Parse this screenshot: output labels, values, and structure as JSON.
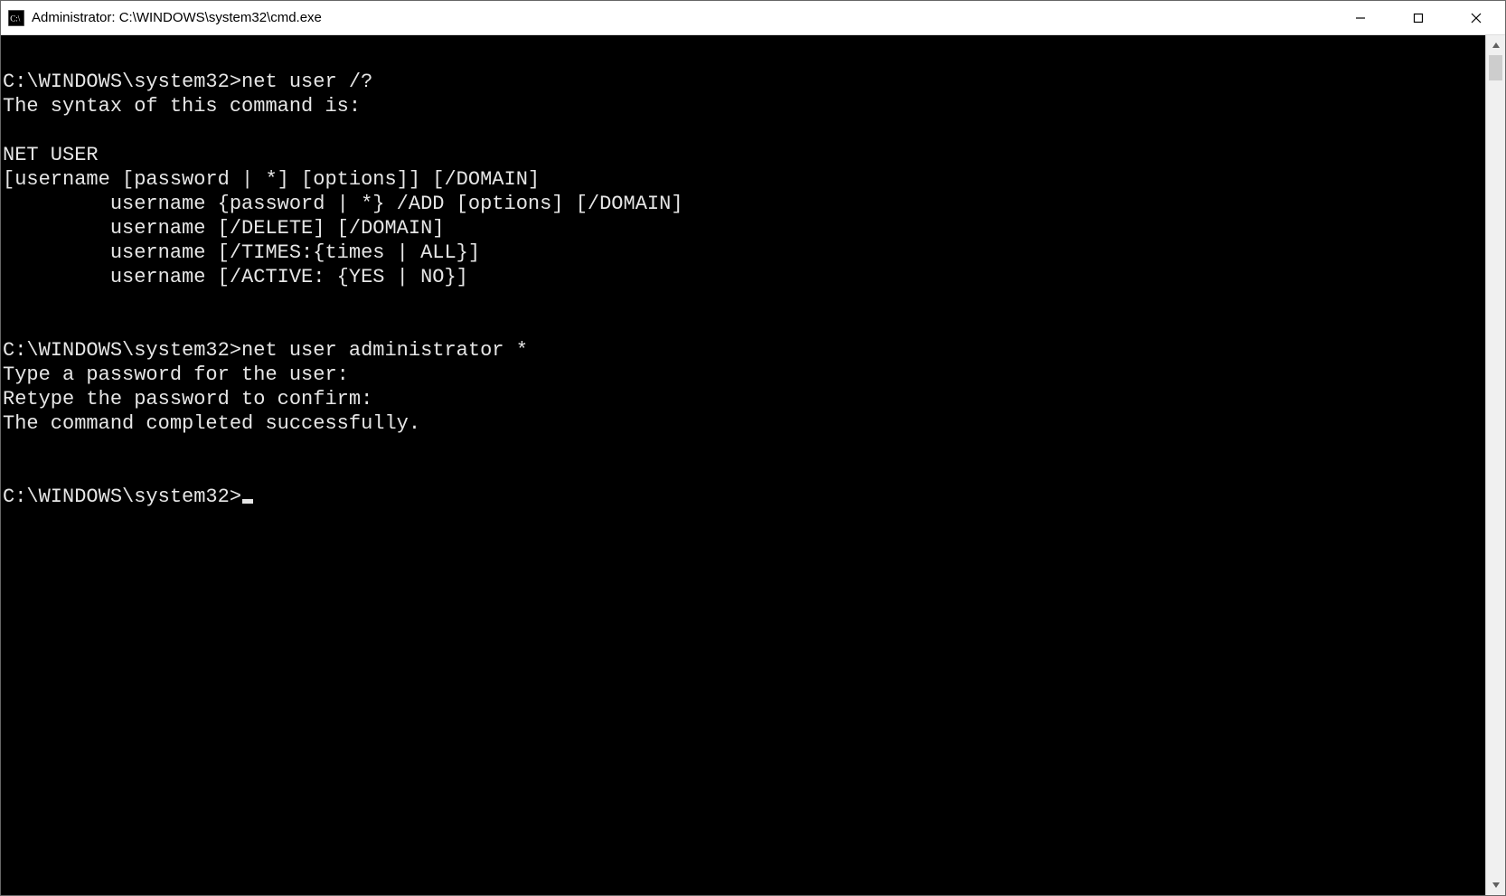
{
  "window": {
    "title": "Administrator: C:\\WINDOWS\\system32\\cmd.exe"
  },
  "terminal": {
    "lines": [
      "C:\\WINDOWS\\system32>net user /?",
      "The syntax of this command is:",
      "",
      "NET USER",
      "[username [password | *] [options]] [/DOMAIN]",
      "         username {password | *} /ADD [options] [/DOMAIN]",
      "         username [/DELETE] [/DOMAIN]",
      "         username [/TIMES:{times | ALL}]",
      "         username [/ACTIVE: {YES | NO}]",
      "",
      "",
      "C:\\WINDOWS\\system32>net user administrator *",
      "Type a password for the user:",
      "Retype the password to confirm:",
      "The command completed successfully.",
      "",
      ""
    ],
    "prompt": "C:\\WINDOWS\\system32>"
  }
}
